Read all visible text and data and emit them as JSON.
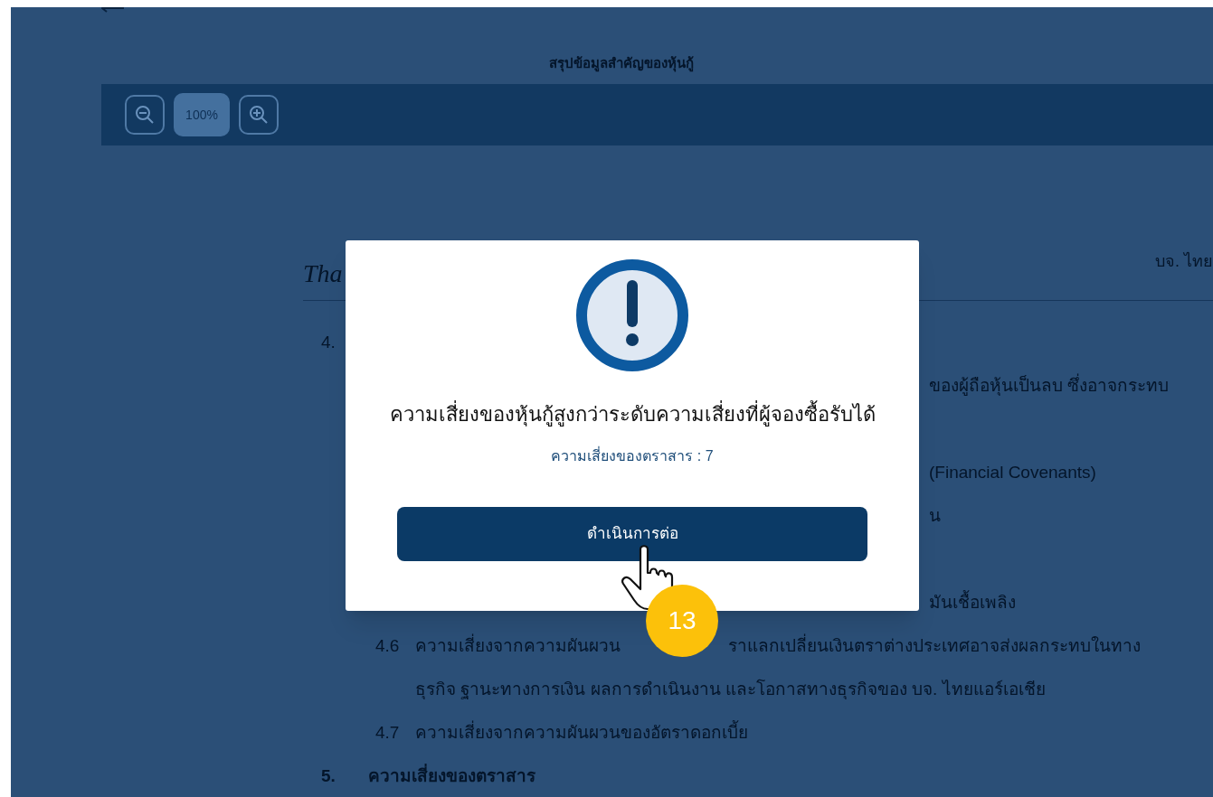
{
  "page": {
    "title": "สรุปข้อมูลสำคัญของหุ้นกู้"
  },
  "toolbar": {
    "zoom_level": "100%"
  },
  "document": {
    "logo": "Tha",
    "issuer": "บจ. ไทย",
    "lines": [
      {
        "kind": "number",
        "number": "4."
      },
      {
        "kind": "fragment",
        "text": "ของผู้ถือหุ้นเป็นลบ ซึ่งอาจกระทบ"
      },
      {
        "kind": "fragment",
        "text": "(Financial Covenants)"
      },
      {
        "kind": "fragment",
        "text": "น"
      },
      {
        "kind": "fragment",
        "text": "มันเชื้อเพลิง"
      },
      {
        "kind": "sub",
        "number": "4.6",
        "text": "ความเสี่ยงจากความผันผวน",
        "text_after": "ราแลกเปลี่ยนเงินตราต่างประเทศอาจส่งผลกระทบในทาง"
      },
      {
        "kind": "continuation",
        "text": "ธุรกิจ ฐานะทางการเงิน ผลการดำเนินงาน และโอกาสทางธุรกิจของ บจ. ไทยแอร์เอเชีย"
      },
      {
        "kind": "sub",
        "number": "4.7",
        "text": "ความเสี่ยงจากความผันผวนของอัตราดอกเบี้ย"
      },
      {
        "kind": "heading",
        "number": "5.",
        "text": "ความเสี่ยงของตราสาร"
      }
    ]
  },
  "dialog": {
    "title": "ความเสี่ยงของหุ้นกู้สูงกว่าระดับความเสี่ยงที่ผู้จองซื้อรับได้",
    "subtitle": "ความเสี่ยงของตราสาร : 7",
    "button": "ดำเนินการต่อ"
  },
  "step_badge": "13"
}
